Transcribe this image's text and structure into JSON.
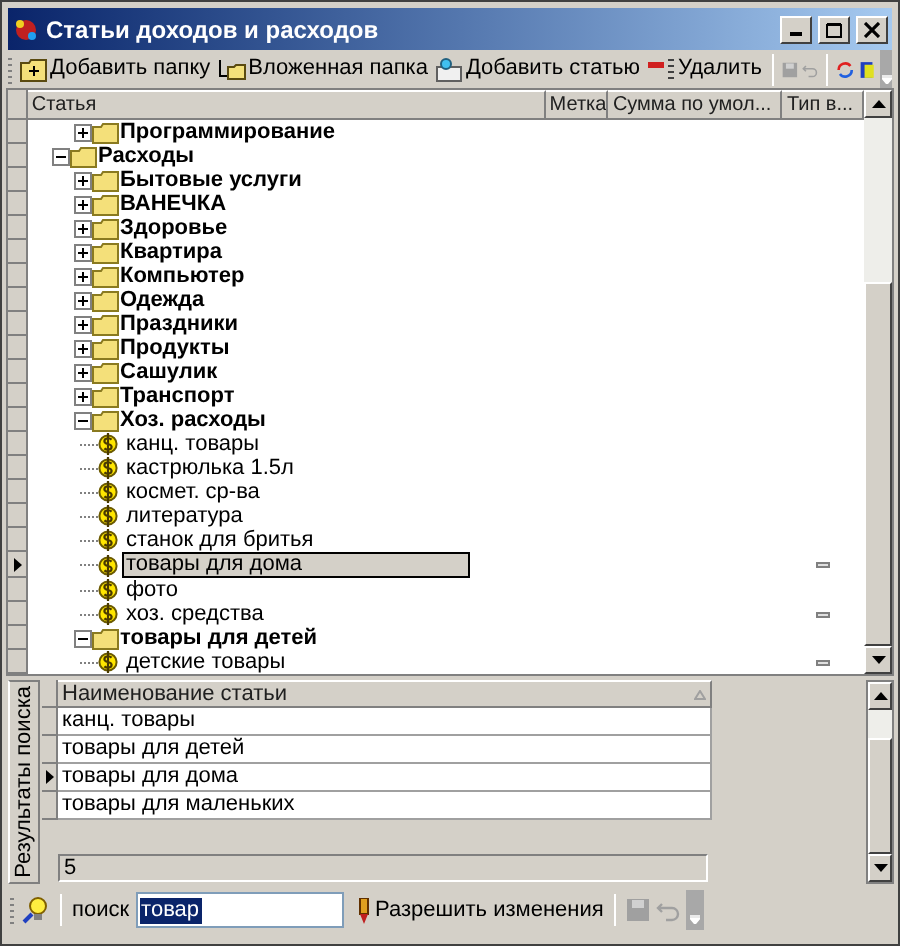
{
  "window": {
    "title": "Статьи доходов и расходов"
  },
  "toolbar": {
    "buttons": [
      "Добавить папку",
      "Вложенная папка",
      "Добавить статью",
      "Удалить"
    ],
    "save_enabled": false,
    "undo_enabled": false
  },
  "columns": [
    "Статья",
    "Метка",
    "Сумма по умол...",
    "Тип в..."
  ],
  "tree": [
    {
      "children": [
        {
          "label": "Программирование",
          "kind": "folder",
          "expanded": false
        }
      ]
    },
    {
      "label": "Расходы",
      "kind": "folder",
      "expanded": true,
      "children": [
        {
          "label": "Бытовые услуги",
          "kind": "folder",
          "expanded": false
        },
        {
          "label": "ВАНЕЧКА",
          "kind": "folder",
          "expanded": false
        },
        {
          "label": "Здоровье",
          "kind": "folder",
          "expanded": false
        },
        {
          "label": "Квартира",
          "kind": "folder",
          "expanded": false
        },
        {
          "label": "Компьютер",
          "kind": "folder",
          "expanded": false
        },
        {
          "label": "Одежда",
          "kind": "folder",
          "expanded": false
        },
        {
          "label": "Праздники",
          "kind": "folder",
          "expanded": false
        },
        {
          "label": "Продукты",
          "kind": "folder",
          "expanded": false
        },
        {
          "label": "Сашулик",
          "kind": "folder",
          "expanded": false
        },
        {
          "label": "Транспорт",
          "kind": "folder",
          "expanded": false
        },
        {
          "label": "Хоз. расходы",
          "kind": "folder",
          "expanded": true,
          "children": [
            {
              "label": "канц. товары",
              "kind": "item",
              "selected": false,
              "flag": false
            },
            {
              "label": "кастрюлька 1.5л",
              "kind": "item",
              "selected": false,
              "flag": false
            },
            {
              "label": "космет. ср-ва",
              "kind": "item",
              "selected": false,
              "flag": false
            },
            {
              "label": "литература",
              "kind": "item",
              "selected": false,
              "flag": false
            },
            {
              "label": "станок для бритья",
              "kind": "item",
              "selected": false,
              "flag": false
            },
            {
              "label": "товары для дома",
              "kind": "item",
              "selected": true,
              "flag": true
            },
            {
              "label": "фото",
              "kind": "item",
              "selected": false,
              "flag": false
            },
            {
              "label": "хоз. средства",
              "kind": "item",
              "selected": false,
              "flag": true
            }
          ]
        },
        {
          "label": "товары для детей",
          "kind": "folder",
          "expanded": true,
          "children": [
            {
              "label": "детские товары",
              "kind": "item",
              "selected": false,
              "flag": true
            }
          ]
        }
      ]
    }
  ],
  "search_results": {
    "tab_label": "Результаты поиска",
    "column": "Наименование статьи",
    "rows": [
      {
        "name": "канц. товары",
        "selected": false
      },
      {
        "name": "товары для детей",
        "selected": false
      },
      {
        "name": "товары для дома",
        "selected": true
      },
      {
        "name": "товары для маленьких",
        "selected": false
      }
    ],
    "count": "5"
  },
  "search_bar": {
    "label": "поиск",
    "value": "товар",
    "allow_button": "Разрешить изменения",
    "save_enabled": false,
    "undo_enabled": false
  }
}
